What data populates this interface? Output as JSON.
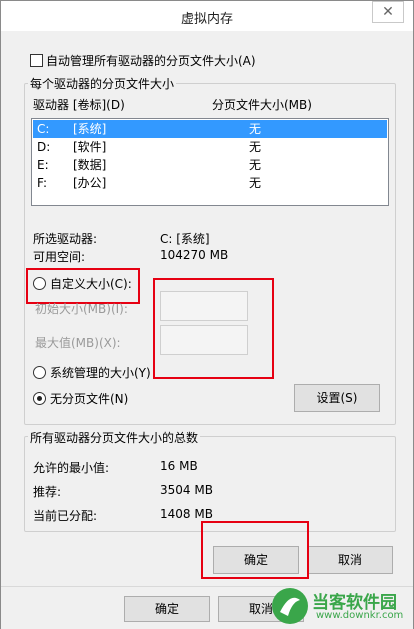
{
  "window": {
    "title": "虚拟内存",
    "close_glyph": "✕"
  },
  "auto_manage_label": "自动管理所有驱动器的分页文件大小(A)",
  "per_drive_group": {
    "legend": "每个驱动器的分页文件大小",
    "col_drive": "驱动器 [卷标](D)",
    "col_size": "分页文件大小(MB)",
    "drives": [
      {
        "letter": "C:",
        "label": "[系统]",
        "size": "无"
      },
      {
        "letter": "D:",
        "label": "[软件]",
        "size": "无"
      },
      {
        "letter": "E:",
        "label": "[数据]",
        "size": "无"
      },
      {
        "letter": "F:",
        "label": "[办公]",
        "size": "无"
      }
    ],
    "selected_drive_label": "所选驱动器:",
    "selected_drive_value": "C:  [系统]",
    "free_space_label": "可用空间:",
    "free_space_value": "104270 MB",
    "custom_size_label": "自定义大小(C):",
    "initial_size_label": "初始大小(MB)(I):",
    "max_size_label": "最大值(MB)(X):",
    "system_managed_label": "系统管理的大小(Y)",
    "no_paging_label": "无分页文件(N)",
    "set_button": "设置(S)"
  },
  "totals_group": {
    "legend": "所有驱动器分页文件大小的总数",
    "min_allowed_label": "允许的最小值:",
    "min_allowed_value": "16 MB",
    "recommended_label": "推荐:",
    "recommended_value": "3504 MB",
    "allocated_label": "当前已分配:",
    "allocated_value": "1408 MB"
  },
  "ok_button": "确定",
  "cancel_button": "取消",
  "behind_ok_button": "确定",
  "behind_cancel_button": "取消",
  "watermark": {
    "text": "当客软件园",
    "url": "www.downkr.com"
  },
  "colors": {
    "highlight": "#3399ff",
    "annotation_red": "#e60012",
    "watermark_green": "#3aa64a"
  }
}
